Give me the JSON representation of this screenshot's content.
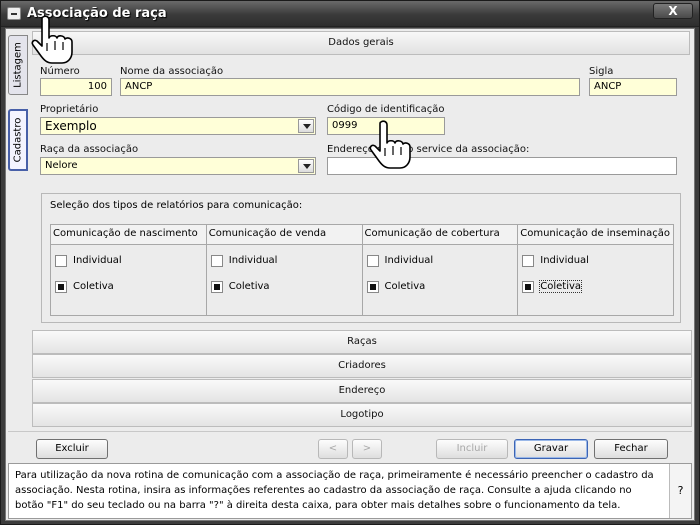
{
  "window": {
    "title": "Associação de raça",
    "close_label": "X"
  },
  "side_tabs": {
    "listagem": "Listagem",
    "cadastro": "Cadastro"
  },
  "sections": {
    "dados_gerais": "Dados gerais"
  },
  "form": {
    "numero": {
      "label": "Número",
      "value": "100"
    },
    "nome": {
      "label": "Nome da associação",
      "value": "ANCP"
    },
    "sigla": {
      "label": "Sigla",
      "value": "ANCP"
    },
    "proprietario": {
      "label": "Proprietário",
      "value": "Exemplo"
    },
    "codigo": {
      "label": "Código de identificação",
      "value": "0999"
    },
    "raca": {
      "label": "Raça da associação",
      "value": "Nelore"
    },
    "endereco": {
      "label": "Endereço do web service da associação:",
      "value": ""
    }
  },
  "report_group": {
    "title": "Seleção dos tipos de relatórios para comunicação:",
    "columns": [
      {
        "header": "Comunicação de nascimento",
        "individual": "Individual",
        "coletiva": "Coletiva",
        "individual_checked": false,
        "coletiva_checked": true
      },
      {
        "header": "Comunicação de venda",
        "individual": "Individual",
        "coletiva": "Coletiva",
        "individual_checked": false,
        "coletiva_checked": true
      },
      {
        "header": "Comunicação de cobertura",
        "individual": "Individual",
        "coletiva": "Coletiva",
        "individual_checked": false,
        "coletiva_checked": true
      },
      {
        "header": "Comunicação de inseminação",
        "individual": "Individual",
        "coletiva": "Coletiva",
        "individual_checked": false,
        "coletiva_checked": true
      }
    ]
  },
  "accordion": [
    "Raças",
    "Criadores",
    "Endereço",
    "Logotipo"
  ],
  "buttons": {
    "excluir": "Excluir",
    "prev": "<",
    "next": ">",
    "incluir": "Incluir",
    "gravar": "Gravar",
    "fechar": "Fechar"
  },
  "help": {
    "text": "Para utilização da nova rotina de comunicação com a associação de raça, primeiramente é necessário preencher o cadastro da associação. Nesta rotina, insira as informações referentes ao cadastro da associação de raça. Consulte a ajuda clicando no botão \"F1\" do seu teclado ou na barra \"?\" à direita desta caixa, para obter mais detalhes sobre o funcionamento da tela.",
    "question": "?"
  },
  "icons": {
    "window_menu": "window-menu-icon",
    "hand_cursor": "hand-pointer-icon",
    "dropdown": "chevron-down-icon"
  }
}
